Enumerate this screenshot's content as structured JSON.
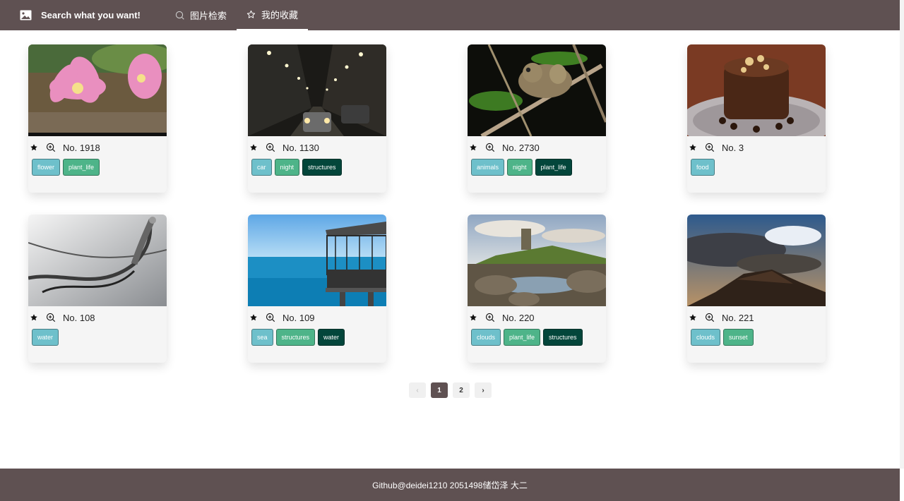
{
  "header": {
    "brand_title": "Search what you want!",
    "tabs": [
      {
        "label": "图片检索",
        "icon": "search-icon",
        "active": false
      },
      {
        "label": "我的收藏",
        "icon": "star-outline-icon",
        "active": true
      }
    ]
  },
  "cards": [
    {
      "number": "No. 1918",
      "image": "pink-cactus-flower",
      "tags": [
        {
          "label": "flower",
          "color": "c0"
        },
        {
          "label": "plant_life",
          "color": "c1"
        }
      ]
    },
    {
      "number": "No. 1130",
      "image": "night-street-cars",
      "tags": [
        {
          "label": "car",
          "color": "c0"
        },
        {
          "label": "night",
          "color": "c1"
        },
        {
          "label": "structures",
          "color": "c2"
        }
      ]
    },
    {
      "number": "No. 2730",
      "image": "frog-on-branch",
      "tags": [
        {
          "label": "animals",
          "color": "c0"
        },
        {
          "label": "night",
          "color": "c1"
        },
        {
          "label": "plant_life",
          "color": "c2"
        }
      ]
    },
    {
      "number": "No. 3",
      "image": "chocolate-cake",
      "tags": [
        {
          "label": "food",
          "color": "c0"
        }
      ]
    },
    {
      "number": "No. 108",
      "image": "water-splash-glass",
      "tags": [
        {
          "label": "water",
          "color": "c0"
        }
      ]
    },
    {
      "number": "No. 109",
      "image": "sea-pier-gazebo",
      "tags": [
        {
          "label": "sea",
          "color": "c0"
        },
        {
          "label": "structures",
          "color": "c1"
        },
        {
          "label": "water",
          "color": "c2"
        }
      ]
    },
    {
      "number": "No. 220",
      "image": "castle-rocky-shore",
      "tags": [
        {
          "label": "clouds",
          "color": "c0"
        },
        {
          "label": "plant_life",
          "color": "c1"
        },
        {
          "label": "structures",
          "color": "c2"
        }
      ]
    },
    {
      "number": "No. 221",
      "image": "sunset-clouds-hill",
      "tags": [
        {
          "label": "clouds",
          "color": "c0"
        },
        {
          "label": "sunset",
          "color": "c1"
        }
      ]
    }
  ],
  "pagination": {
    "prev": "‹",
    "pages": [
      {
        "label": "1",
        "active": true
      },
      {
        "label": "2",
        "active": false
      }
    ],
    "next": "›"
  },
  "footer": {
    "text": "Github@deidei1210 2051498储岱泽 大二"
  },
  "colors": {
    "header": "#5f5152",
    "tag_primary": "#6ec0cb",
    "tag_secondary": "#4eb489",
    "tag_tertiary": "#03463b"
  }
}
